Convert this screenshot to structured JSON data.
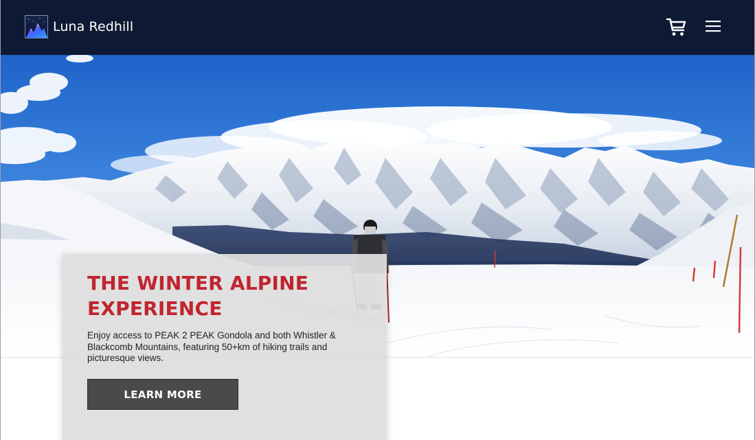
{
  "header": {
    "brand_name": "Luna Redhill",
    "logo_icon": "mountain-logo-icon",
    "cart_icon": "shopping-cart-icon",
    "menu_icon": "hamburger-menu-icon",
    "background_color": "#0e1a33"
  },
  "hero": {
    "image": "snowy-mountain-skier-photo",
    "title": "THE WINTER ALPINE EXPERIENCE",
    "description": "Enjoy access to PEAK 2 PEAK Gondola and both Whistler & Blackcomb Mountains, featuring 50+km of hiking trails and picturesque views.",
    "button_label": "LEARN MORE",
    "title_color": "#c0252f",
    "button_color": "#4a4a4a"
  }
}
